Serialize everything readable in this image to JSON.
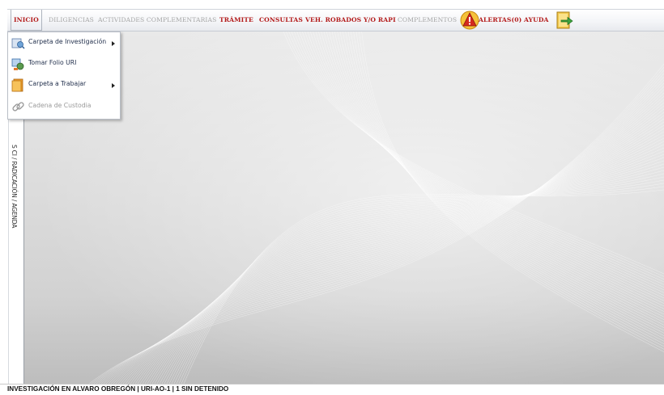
{
  "menu": {
    "inicio": "INICIO",
    "diligencias": "DILIGENCIAS",
    "actividades": "ACTIVIDADES COMPLEMENTARIAS",
    "tramite": "TRÁMITE",
    "consultas": "CONSULTAS",
    "vehiculos": "VEH. ROBADOS Y/O RAPI",
    "complementos": "COMPLEMENTOS",
    "alertas": "ALERTAS(0)",
    "ayuda": "AYUDA"
  },
  "dropdown": {
    "items": [
      {
        "label": "Carpeta de Investigación",
        "icon": "investigation-icon",
        "submenu": true,
        "enabled": true
      },
      {
        "label": "Tomar Folio URI",
        "icon": "folio-icon",
        "submenu": false,
        "enabled": true
      },
      {
        "label": "Carpeta a Trabajar",
        "icon": "folder-icon",
        "submenu": true,
        "enabled": true
      },
      {
        "label": "Cadena de Custodia",
        "icon": "chain-link-icon",
        "submenu": false,
        "enabled": false
      }
    ]
  },
  "side_tab": {
    "label": "S CI / RADICACIÓN / AGENDA"
  },
  "status": {
    "text": "INVESTIGACIÓN EN ALVARO OBREGÓN | URI-AO-1 | 1 SIN DETENIDO"
  },
  "colors": {
    "menu_active": "#b31b1b",
    "menu_disabled": "#a5a5a5",
    "status_text": "#111111"
  }
}
